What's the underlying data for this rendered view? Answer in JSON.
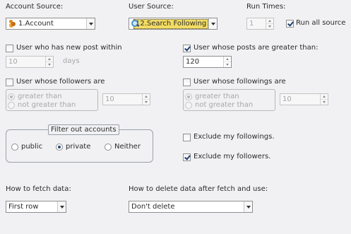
{
  "account_source": {
    "label": "Account Source:",
    "value": "1.Account",
    "icon": "account-icon"
  },
  "user_source": {
    "label": "User Source:",
    "value": "12.Search Following",
    "icon": "search-icon"
  },
  "run_times": {
    "label": "Run Times:",
    "value": "1",
    "run_all_label": "Run all source",
    "run_all_checked": true
  },
  "new_post": {
    "label": "User who has new post within",
    "value": "10",
    "unit": "days",
    "checked": false
  },
  "posts_greater": {
    "label": "User whose posts are greater than:",
    "value": "120",
    "checked": true
  },
  "followers": {
    "label": "User whose followers are",
    "checked": false,
    "options": [
      "greater than",
      "not greater than"
    ],
    "selected": "greater than",
    "value": "10"
  },
  "followings": {
    "label": "User whose followings are",
    "checked": false,
    "options": [
      "greater than",
      "not greater than"
    ],
    "selected": "greater than",
    "value": "10"
  },
  "filter": {
    "title": "Filter out accounts",
    "options": [
      "public",
      "private",
      "Neither"
    ],
    "selected": "private"
  },
  "exclude_followings": {
    "label": "Exclude my followings.",
    "checked": false
  },
  "exclude_followers": {
    "label": "Exclude my followers.",
    "checked": true
  },
  "fetch": {
    "label": "How to fetch data:",
    "value": "First row"
  },
  "delete": {
    "label": "How to delete data after fetch and use:",
    "value": "Don't delete"
  }
}
